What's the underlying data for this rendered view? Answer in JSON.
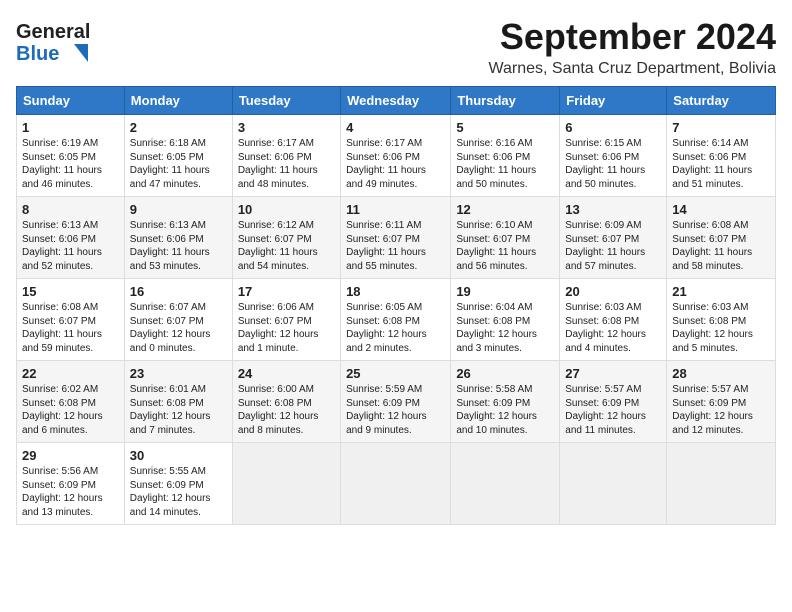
{
  "header": {
    "logo_line1": "General",
    "logo_line2": "Blue",
    "main_title": "September 2024",
    "subtitle": "Warnes, Santa Cruz Department, Bolivia"
  },
  "weekdays": [
    "Sunday",
    "Monday",
    "Tuesday",
    "Wednesday",
    "Thursday",
    "Friday",
    "Saturday"
  ],
  "weeks": [
    [
      {
        "day": "1",
        "info": "Sunrise: 6:19 AM\nSunset: 6:05 PM\nDaylight: 11 hours\nand 46 minutes."
      },
      {
        "day": "2",
        "info": "Sunrise: 6:18 AM\nSunset: 6:05 PM\nDaylight: 11 hours\nand 47 minutes."
      },
      {
        "day": "3",
        "info": "Sunrise: 6:17 AM\nSunset: 6:06 PM\nDaylight: 11 hours\nand 48 minutes."
      },
      {
        "day": "4",
        "info": "Sunrise: 6:17 AM\nSunset: 6:06 PM\nDaylight: 11 hours\nand 49 minutes."
      },
      {
        "day": "5",
        "info": "Sunrise: 6:16 AM\nSunset: 6:06 PM\nDaylight: 11 hours\nand 50 minutes."
      },
      {
        "day": "6",
        "info": "Sunrise: 6:15 AM\nSunset: 6:06 PM\nDaylight: 11 hours\nand 50 minutes."
      },
      {
        "day": "7",
        "info": "Sunrise: 6:14 AM\nSunset: 6:06 PM\nDaylight: 11 hours\nand 51 minutes."
      }
    ],
    [
      {
        "day": "8",
        "info": "Sunrise: 6:13 AM\nSunset: 6:06 PM\nDaylight: 11 hours\nand 52 minutes."
      },
      {
        "day": "9",
        "info": "Sunrise: 6:13 AM\nSunset: 6:06 PM\nDaylight: 11 hours\nand 53 minutes."
      },
      {
        "day": "10",
        "info": "Sunrise: 6:12 AM\nSunset: 6:07 PM\nDaylight: 11 hours\nand 54 minutes."
      },
      {
        "day": "11",
        "info": "Sunrise: 6:11 AM\nSunset: 6:07 PM\nDaylight: 11 hours\nand 55 minutes."
      },
      {
        "day": "12",
        "info": "Sunrise: 6:10 AM\nSunset: 6:07 PM\nDaylight: 11 hours\nand 56 minutes."
      },
      {
        "day": "13",
        "info": "Sunrise: 6:09 AM\nSunset: 6:07 PM\nDaylight: 11 hours\nand 57 minutes."
      },
      {
        "day": "14",
        "info": "Sunrise: 6:08 AM\nSunset: 6:07 PM\nDaylight: 11 hours\nand 58 minutes."
      }
    ],
    [
      {
        "day": "15",
        "info": "Sunrise: 6:08 AM\nSunset: 6:07 PM\nDaylight: 11 hours\nand 59 minutes."
      },
      {
        "day": "16",
        "info": "Sunrise: 6:07 AM\nSunset: 6:07 PM\nDaylight: 12 hours\nand 0 minutes."
      },
      {
        "day": "17",
        "info": "Sunrise: 6:06 AM\nSunset: 6:07 PM\nDaylight: 12 hours\nand 1 minute."
      },
      {
        "day": "18",
        "info": "Sunrise: 6:05 AM\nSunset: 6:08 PM\nDaylight: 12 hours\nand 2 minutes."
      },
      {
        "day": "19",
        "info": "Sunrise: 6:04 AM\nSunset: 6:08 PM\nDaylight: 12 hours\nand 3 minutes."
      },
      {
        "day": "20",
        "info": "Sunrise: 6:03 AM\nSunset: 6:08 PM\nDaylight: 12 hours\nand 4 minutes."
      },
      {
        "day": "21",
        "info": "Sunrise: 6:03 AM\nSunset: 6:08 PM\nDaylight: 12 hours\nand 5 minutes."
      }
    ],
    [
      {
        "day": "22",
        "info": "Sunrise: 6:02 AM\nSunset: 6:08 PM\nDaylight: 12 hours\nand 6 minutes."
      },
      {
        "day": "23",
        "info": "Sunrise: 6:01 AM\nSunset: 6:08 PM\nDaylight: 12 hours\nand 7 minutes."
      },
      {
        "day": "24",
        "info": "Sunrise: 6:00 AM\nSunset: 6:08 PM\nDaylight: 12 hours\nand 8 minutes."
      },
      {
        "day": "25",
        "info": "Sunrise: 5:59 AM\nSunset: 6:09 PM\nDaylight: 12 hours\nand 9 minutes."
      },
      {
        "day": "26",
        "info": "Sunrise: 5:58 AM\nSunset: 6:09 PM\nDaylight: 12 hours\nand 10 minutes."
      },
      {
        "day": "27",
        "info": "Sunrise: 5:57 AM\nSunset: 6:09 PM\nDaylight: 12 hours\nand 11 minutes."
      },
      {
        "day": "28",
        "info": "Sunrise: 5:57 AM\nSunset: 6:09 PM\nDaylight: 12 hours\nand 12 minutes."
      }
    ],
    [
      {
        "day": "29",
        "info": "Sunrise: 5:56 AM\nSunset: 6:09 PM\nDaylight: 12 hours\nand 13 minutes."
      },
      {
        "day": "30",
        "info": "Sunrise: 5:55 AM\nSunset: 6:09 PM\nDaylight: 12 hours\nand 14 minutes."
      },
      {
        "day": "",
        "info": ""
      },
      {
        "day": "",
        "info": ""
      },
      {
        "day": "",
        "info": ""
      },
      {
        "day": "",
        "info": ""
      },
      {
        "day": "",
        "info": ""
      }
    ]
  ]
}
